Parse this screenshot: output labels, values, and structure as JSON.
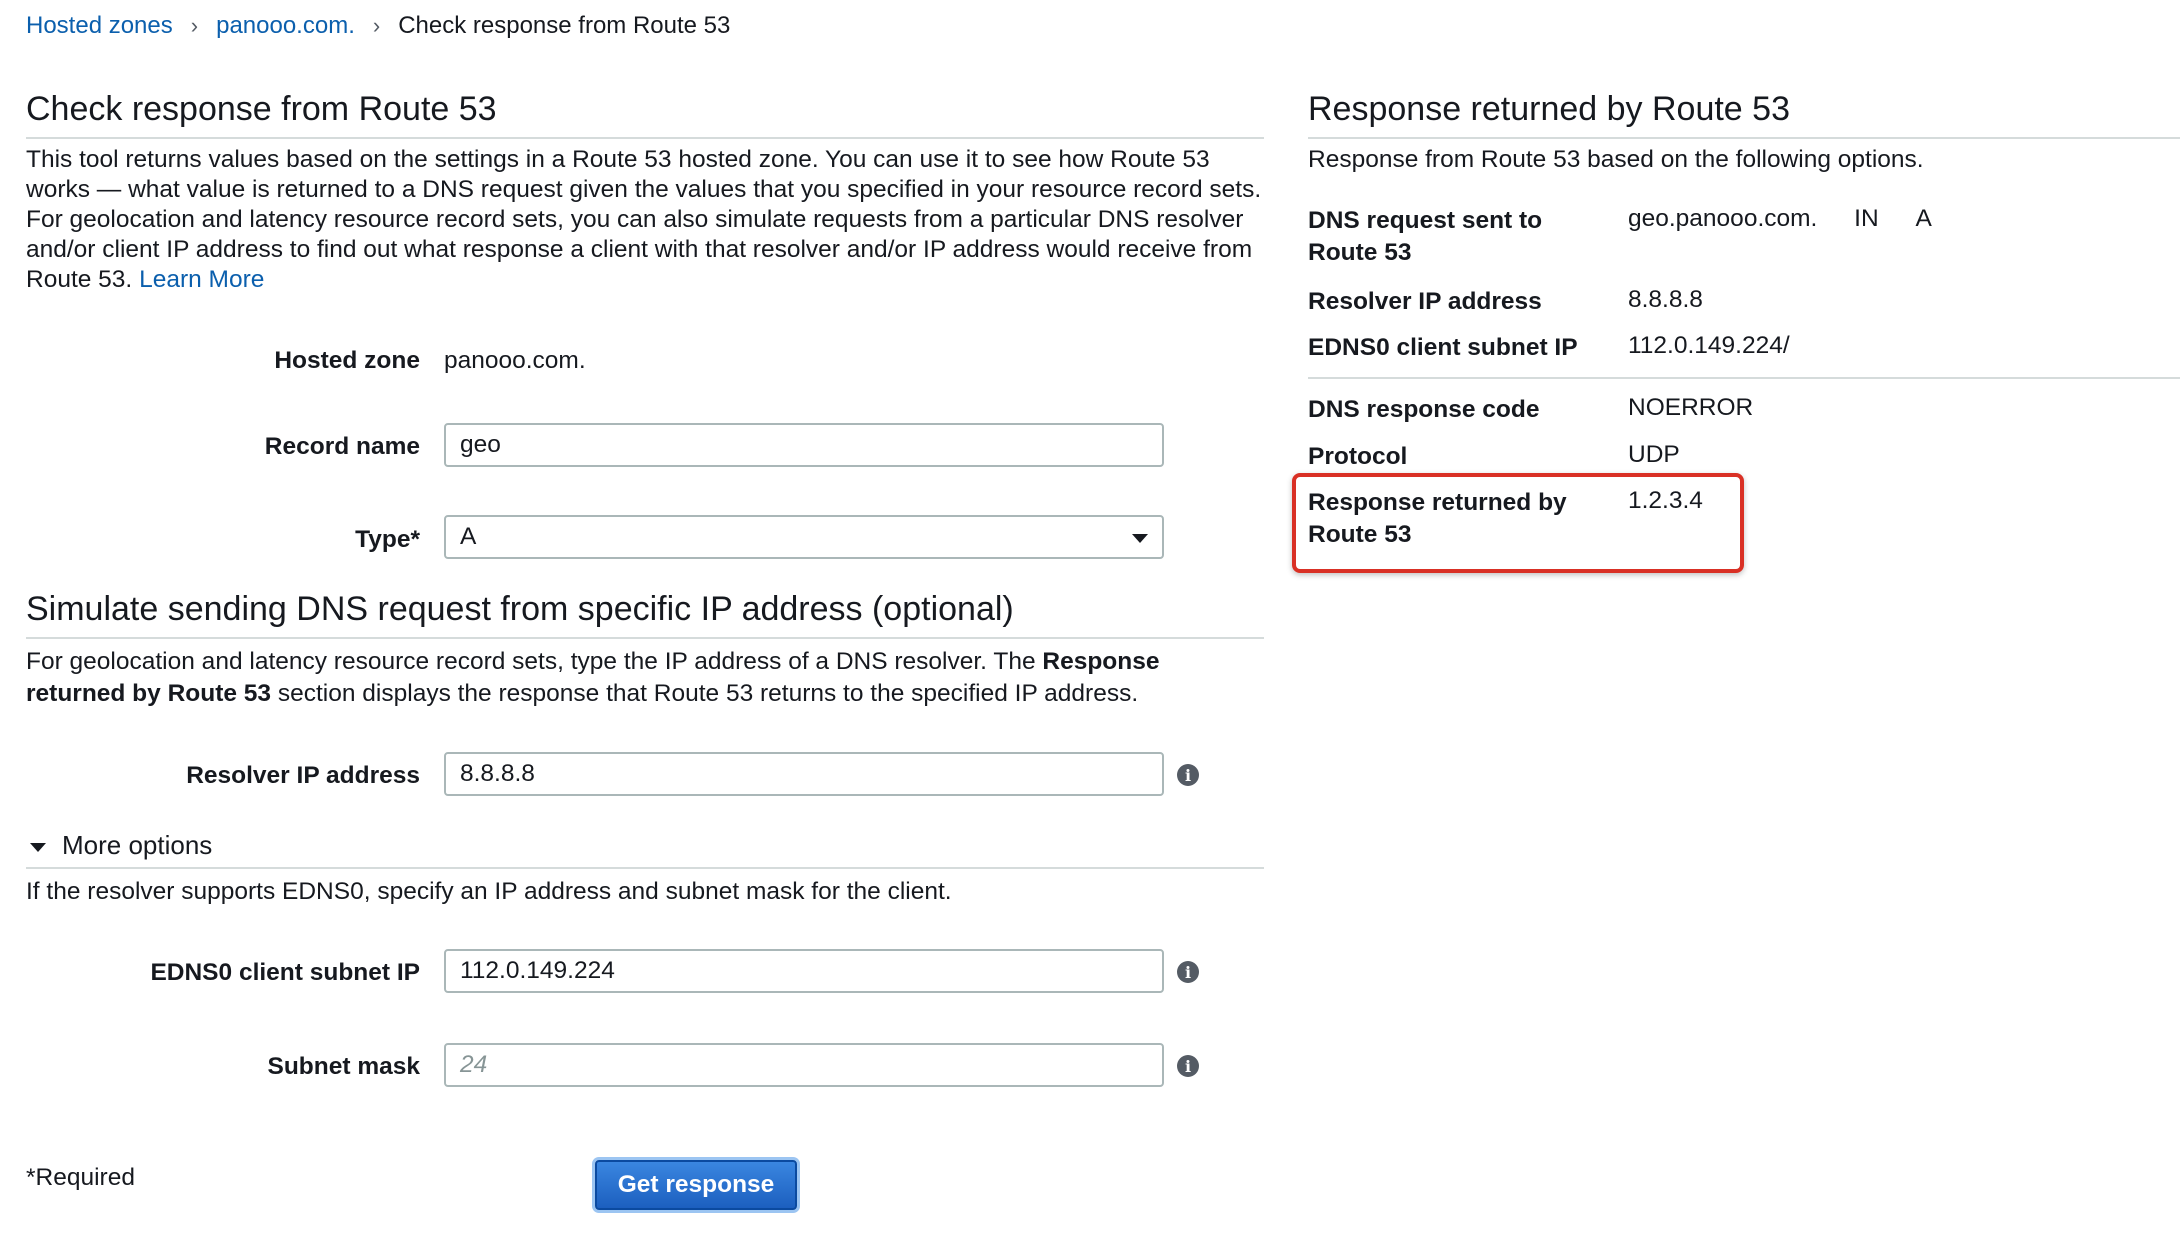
{
  "breadcrumb": {
    "item1": "Hosted zones",
    "item2": "panooo.com.",
    "current": "Check response from Route 53",
    "separator": "›"
  },
  "left": {
    "title": "Check response from Route 53",
    "intro": "This tool returns values based on the settings in a Route 53 hosted zone. You can use it to see how Route 53 works — what value is returned to a DNS request given the values that you specified in your resource record sets. For geolocation and latency resource record sets, you can also simulate requests from a particular DNS resolver and/or client IP address to find out what response a client with that resolver and/or IP address would receive from Route 53.",
    "learn_more": "Learn More",
    "hosted_zone_label": "Hosted zone",
    "hosted_zone_value": "panooo.com.",
    "record_name_label": "Record name",
    "record_name_value": "geo",
    "type_label": "Type*",
    "type_value": "A",
    "simulate_title": "Simulate sending DNS request from specific IP address (optional)",
    "simulate_text_1": "For geolocation and latency resource record sets, type the IP address of a DNS resolver. The ",
    "simulate_bold": "Response returned by Route 53",
    "simulate_text_2": " section displays the response that Route 53 returns to the specified IP address.",
    "resolver_label": "Resolver IP address",
    "resolver_value": "8.8.8.8",
    "more_options": "More options",
    "edns_text": "If the resolver supports EDNS0, specify an IP address and subnet mask for the client.",
    "edns_label": "EDNS0 client subnet IP",
    "edns_value": "112.0.149.224",
    "subnet_label": "Subnet mask",
    "subnet_placeholder": "24",
    "required_note": "*Required",
    "get_response_button": "Get response",
    "info_glyph": "i"
  },
  "right": {
    "title": "Response returned by Route 53",
    "subtitle": "Response from Route 53 based on the following options.",
    "dns_request_label": "DNS request sent to Route 53",
    "dns_request_host": "geo.panooo.com.",
    "dns_request_class": "IN",
    "dns_request_type": "A",
    "resolver_label": "Resolver IP address",
    "resolver_value": "8.8.8.8",
    "edns_label": "EDNS0 client subnet IP",
    "edns_value": "112.0.149.224/",
    "response_code_label": "DNS response code",
    "response_code_value": "NOERROR",
    "protocol_label": "Protocol",
    "protocol_value": "UDP",
    "response_label": "Response returned by Route 53",
    "response_value": "1.2.3.4"
  },
  "colors": {
    "link": "#0b5fad",
    "button": "#1c5fbf",
    "highlight_border": "#d93025"
  }
}
